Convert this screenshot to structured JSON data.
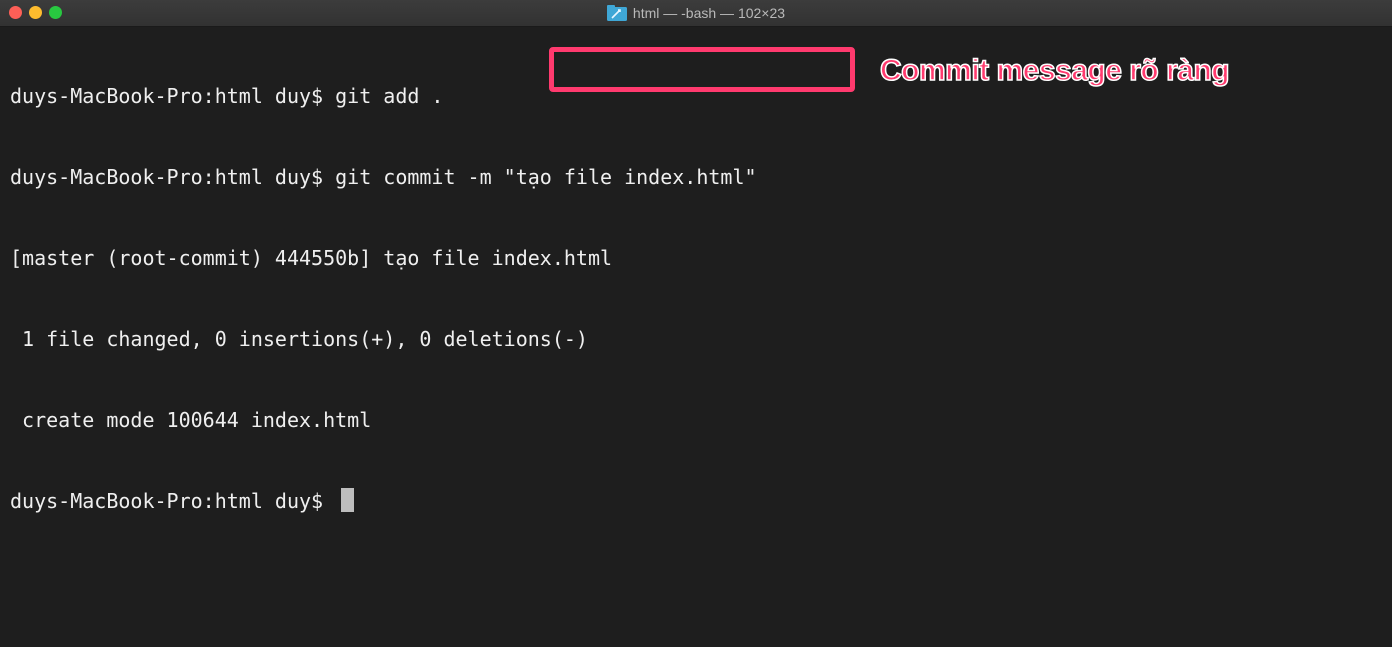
{
  "window": {
    "title": "html — -bash — 102×23",
    "icon": "folder-icon",
    "traffic_lights": {
      "close_color": "#fe5f57",
      "minimize_color": "#febc2e",
      "zoom_color": "#28c840"
    }
  },
  "terminal": {
    "lines": [
      "duys-MacBook-Pro:html duy$ git add .",
      "duys-MacBook-Pro:html duy$ git commit -m \"tạo file index.html\"",
      "[master (root-commit) 444550b] tạo file index.html",
      " 1 file changed, 0 insertions(+), 0 deletions(-)",
      " create mode 100644 index.html",
      "duys-MacBook-Pro:html duy$ "
    ],
    "background": "#1e1e1e",
    "foreground": "#efefef"
  },
  "annotation": {
    "label": "Commit message rõ ràng",
    "color": "#ff3a6e"
  }
}
